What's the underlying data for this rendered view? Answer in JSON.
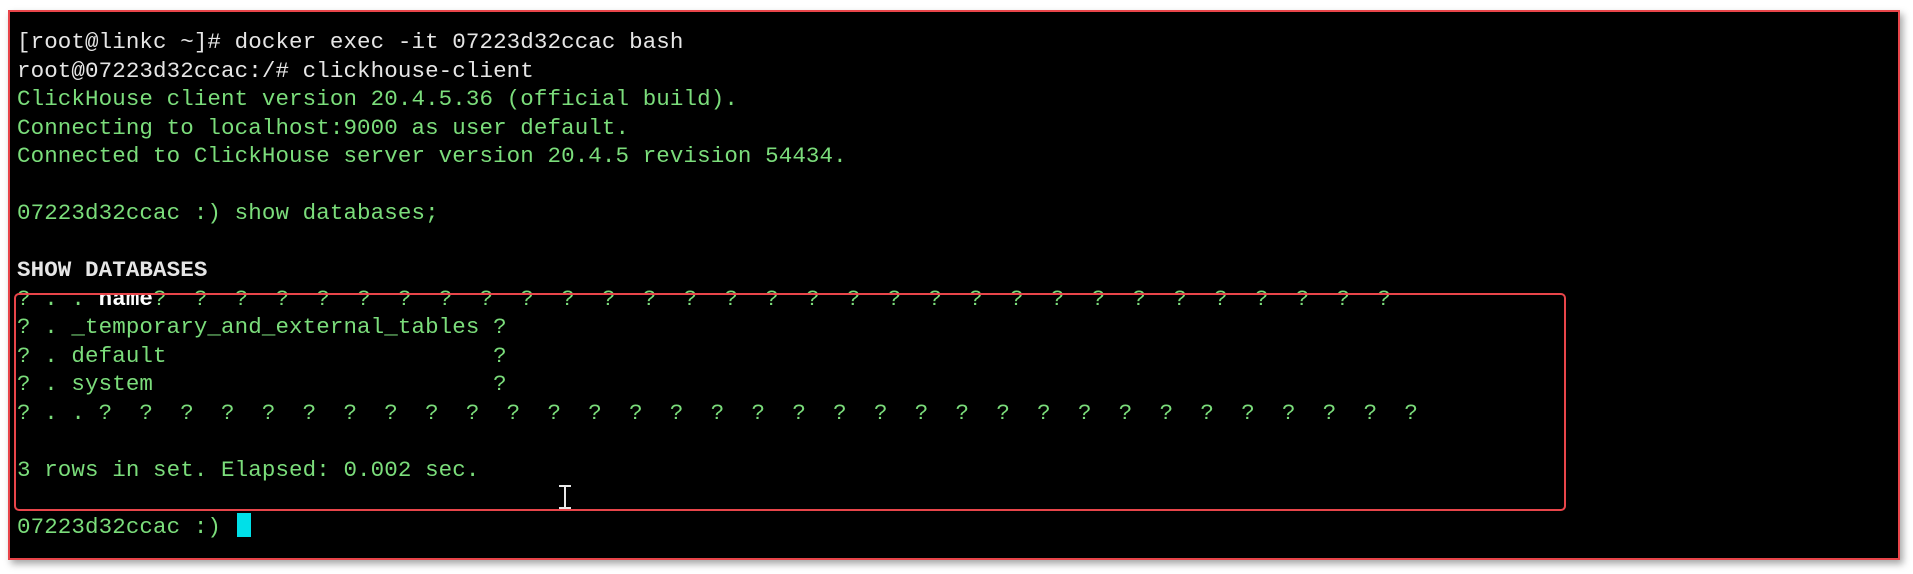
{
  "terminal": {
    "lines": [
      {
        "text": "[root@linkc ~]# docker exec -it 07223d32ccac bash",
        "style": "white"
      },
      {
        "text": "root@07223d32ccac:/# clickhouse-client",
        "style": "white"
      },
      {
        "text": "ClickHouse client version 20.4.5.36 (official build).",
        "style": "green"
      },
      {
        "text": "Connecting to localhost:9000 as user default.",
        "style": "green"
      },
      {
        "text": "Connected to ClickHouse server version 20.4.5 revision 54434.",
        "style": "green"
      },
      {
        "text": "",
        "style": "green"
      },
      {
        "text": "07223d32ccac :) show databases;",
        "style": "green"
      },
      {
        "text": "",
        "style": "green"
      },
      {
        "text": "SHOW DATABASES",
        "style": "white-bold"
      }
    ],
    "result_header": {
      "prefix": "? . . ",
      "column": "name",
      "suffix": "?  ?  ?  ?  ?  ?  ?  ?  ?  ?  ?  ?  ?  ?  ?  ?  ?  ?  ?  ?  ?  ?  ?  ?  ?  ?  ?  ?  ?  ?  ?"
    },
    "result_rows": [
      "? . _temporary_and_external_tables ?",
      "? . default                        ?",
      "? . system                         ?"
    ],
    "result_footer": "? . . ?  ?  ?  ?  ?  ?  ?  ?  ?  ?  ?  ?  ?  ?  ?  ?  ?  ?  ?  ?  ?  ?  ?  ?  ?  ?  ?  ?  ?  ?  ?  ?  ?",
    "summary": "3 rows in set. Elapsed: 0.002 sec.",
    "prompt": "07223d32ccac :) "
  },
  "colors": {
    "background": "#000000",
    "text_green": "#7bdd7b",
    "text_white": "#e6e6e6",
    "highlight": "#e8454a",
    "cursor": "#00e0e8"
  },
  "icons": {
    "text_cursor": "ibeam-cursor-icon",
    "terminal_cursor": "block-cursor"
  }
}
